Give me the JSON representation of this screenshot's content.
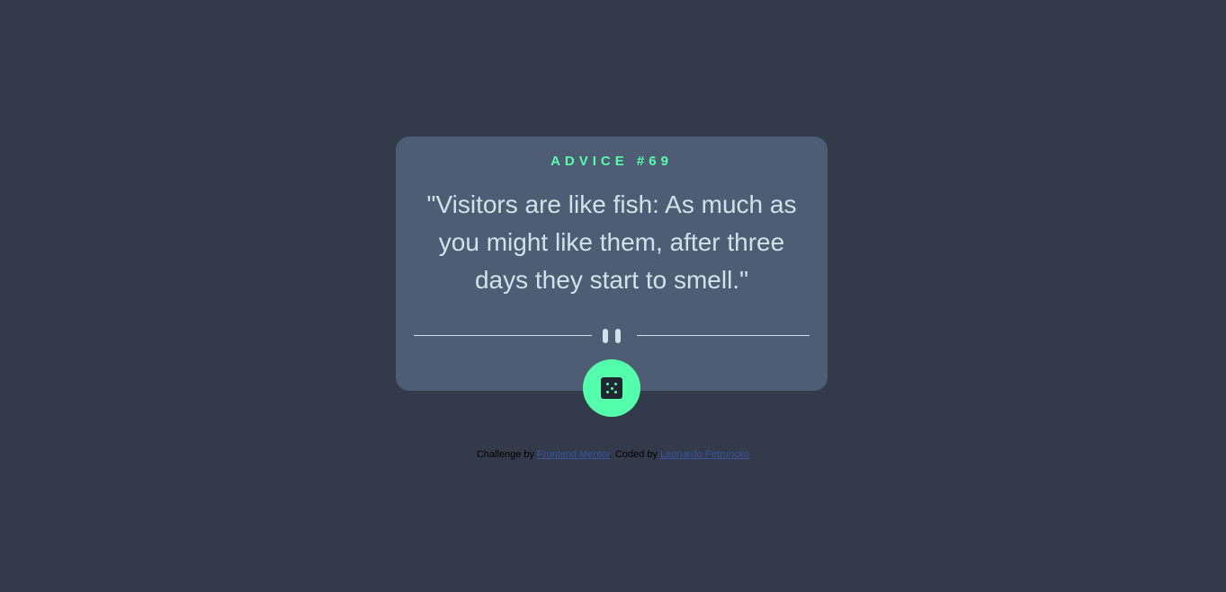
{
  "card": {
    "advice_label": "ADVICE #69",
    "quote": "\"Visitors are like fish: As much as you might like them, after three days they start to smell.\""
  },
  "dice_button": {
    "icon": "dice-icon"
  },
  "footer": {
    "challenge_text": "Challenge by ",
    "challenge_link": "Frontend Mentor",
    "separator": ". Coded by ",
    "author_link": "Leonardo Petruncko"
  },
  "colors": {
    "background": "#333a49",
    "card": "#4f5d74",
    "accent": "#53ffab",
    "text": "#cee3e9",
    "link": "#3e52a3"
  }
}
